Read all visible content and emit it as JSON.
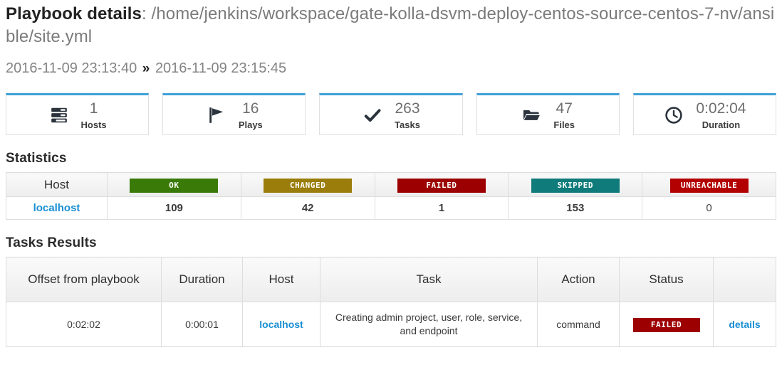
{
  "header": {
    "label": "Playbook details",
    "separator": ": ",
    "path": "/home/jenkins/workspace/gate-kolla-dsvm-deploy-centos-source-centos-7-nv/ansible/site.yml",
    "start_time": "2016-11-09 23:13:40",
    "time_separator": "»",
    "end_time": "2016-11-09 23:15:45"
  },
  "accent_color": "#3fa0d8",
  "link_color": "#1b8fd4",
  "cards": [
    {
      "icon": "server-icon",
      "value": "1",
      "label": "Hosts"
    },
    {
      "icon": "flag-icon",
      "value": "16",
      "label": "Plays"
    },
    {
      "icon": "check-icon",
      "value": "263",
      "label": "Tasks"
    },
    {
      "icon": "folder-icon",
      "value": "47",
      "label": "Files"
    },
    {
      "icon": "clock-icon",
      "value": "0:02:04",
      "label": "Duration"
    }
  ],
  "statistics": {
    "title": "Statistics",
    "columns": [
      {
        "key": "host",
        "label": "Host",
        "badge": false,
        "color": ""
      },
      {
        "key": "ok",
        "label": "OK",
        "badge": true,
        "color": "#3a7a09"
      },
      {
        "key": "changed",
        "label": "CHANGED",
        "badge": true,
        "color": "#9a7d0a"
      },
      {
        "key": "failed",
        "label": "FAILED",
        "badge": true,
        "color": "#9c0000"
      },
      {
        "key": "skipped",
        "label": "SKIPPED",
        "badge": true,
        "color": "#0f7b7b"
      },
      {
        "key": "unreachable",
        "label": "UNREACHABLE",
        "badge": true,
        "color": "#b30000"
      }
    ],
    "rows": [
      {
        "host": "localhost",
        "ok": "109",
        "changed": "42",
        "failed": "1",
        "skipped": "153",
        "unreachable": "0"
      }
    ]
  },
  "tasks_results": {
    "title": "Tasks Results",
    "columns": [
      {
        "key": "offset",
        "label": "Offset from playbook"
      },
      {
        "key": "duration",
        "label": "Duration"
      },
      {
        "key": "host",
        "label": "Host"
      },
      {
        "key": "task",
        "label": "Task"
      },
      {
        "key": "action",
        "label": "Action"
      },
      {
        "key": "status",
        "label": "Status"
      },
      {
        "key": "details",
        "label": ""
      }
    ],
    "rows": [
      {
        "offset": "0:02:02",
        "duration": "0:00:01",
        "host": "localhost",
        "task": "Creating admin project, user, role, service, and endpoint",
        "action": "command",
        "status": "FAILED",
        "details": "details"
      }
    ]
  }
}
